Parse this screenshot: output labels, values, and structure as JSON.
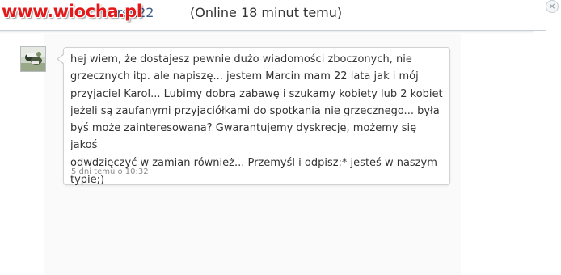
{
  "watermark": "www.wiocha.pl",
  "header": {
    "username": "orek22",
    "status": "(Online 18 minut temu)",
    "close_glyph": "×"
  },
  "conversation": {
    "avatar_icon": "user-avatar-photo",
    "message": {
      "text": "hej wiem, że dostajesz pewnie dużo wiadomości zboczonych, nie\ngrzecznych itp. ale napiszę... jestem Marcin mam 22 lata jak i mój\nprzyjaciel Karol... Lubimy dobrą zabawę i szukamy kobiety lub 2 kobiet\njeżeli są zaufanymi przyjaciółkami do spotkania nie grzecznego... była\nbyś może zainteresowana? Gwarantujemy dyskrecję, możemy się jakoś\nodwdzięczyć w zamian również... Przemyśl i odpisz:* jesteś w naszym\ntypie;)",
      "timestamp": "5 dni temu o 10:32"
    }
  },
  "colors": {
    "watermark": "#e41a1a",
    "username": "#3b5f8a",
    "text": "#333333",
    "timestamp": "#8d8d8d",
    "bubble_border": "#d2d2d2"
  }
}
